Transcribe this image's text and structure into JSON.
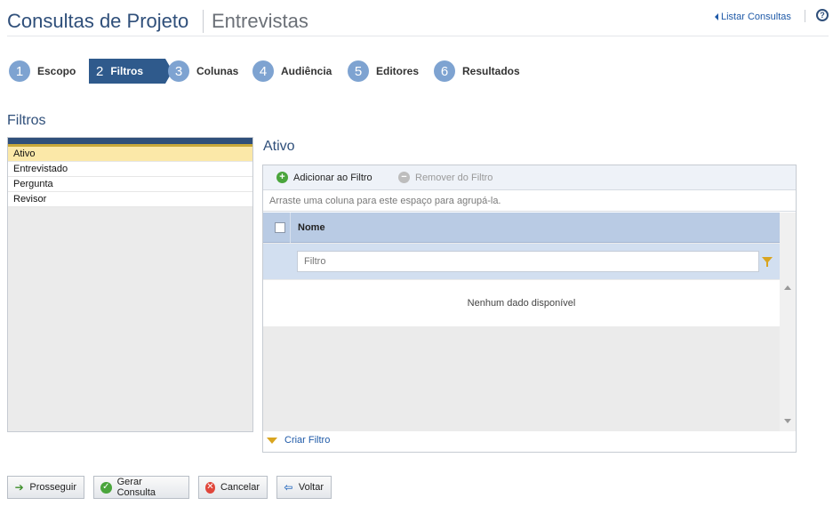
{
  "header": {
    "title": "Consultas de Projeto",
    "subtitle": "Entrevistas",
    "list_link": "Listar Consultas",
    "help_icon": "?"
  },
  "steps": [
    {
      "num": "1",
      "label": "Escopo"
    },
    {
      "num": "2",
      "label": "Filtros",
      "active": true
    },
    {
      "num": "3",
      "label": "Colunas"
    },
    {
      "num": "4",
      "label": "Audiência"
    },
    {
      "num": "5",
      "label": "Editores"
    },
    {
      "num": "6",
      "label": "Resultados"
    }
  ],
  "section_title": "Filtros",
  "left_list": {
    "items": [
      "Ativo",
      "Entrevistado",
      "Pergunta",
      "Revisor"
    ],
    "selected": "Ativo"
  },
  "right": {
    "title": "Ativo",
    "toolbar": {
      "add_label": "Adicionar ao Filtro",
      "remove_label": "Remover do Filtro"
    },
    "group_hint": "Arraste uma coluna para este espaço para agrupá-la.",
    "column_header": "Nome",
    "filter_placeholder": "Filtro",
    "empty_text": "Nenhum dado disponível",
    "create_filter": "Criar Filtro"
  },
  "buttons": {
    "proceed": "Prosseguir",
    "generate": "Gerar Consulta",
    "cancel": "Cancelar",
    "back": "Voltar"
  },
  "colors": {
    "brand_blue": "#2f4f7a",
    "step_active": "#2f5a8c",
    "step_circle": "#7ea3d1",
    "link": "#1f5aa8",
    "selected_row": "#fbe8a8",
    "grid_header": "#b9cbe4"
  }
}
